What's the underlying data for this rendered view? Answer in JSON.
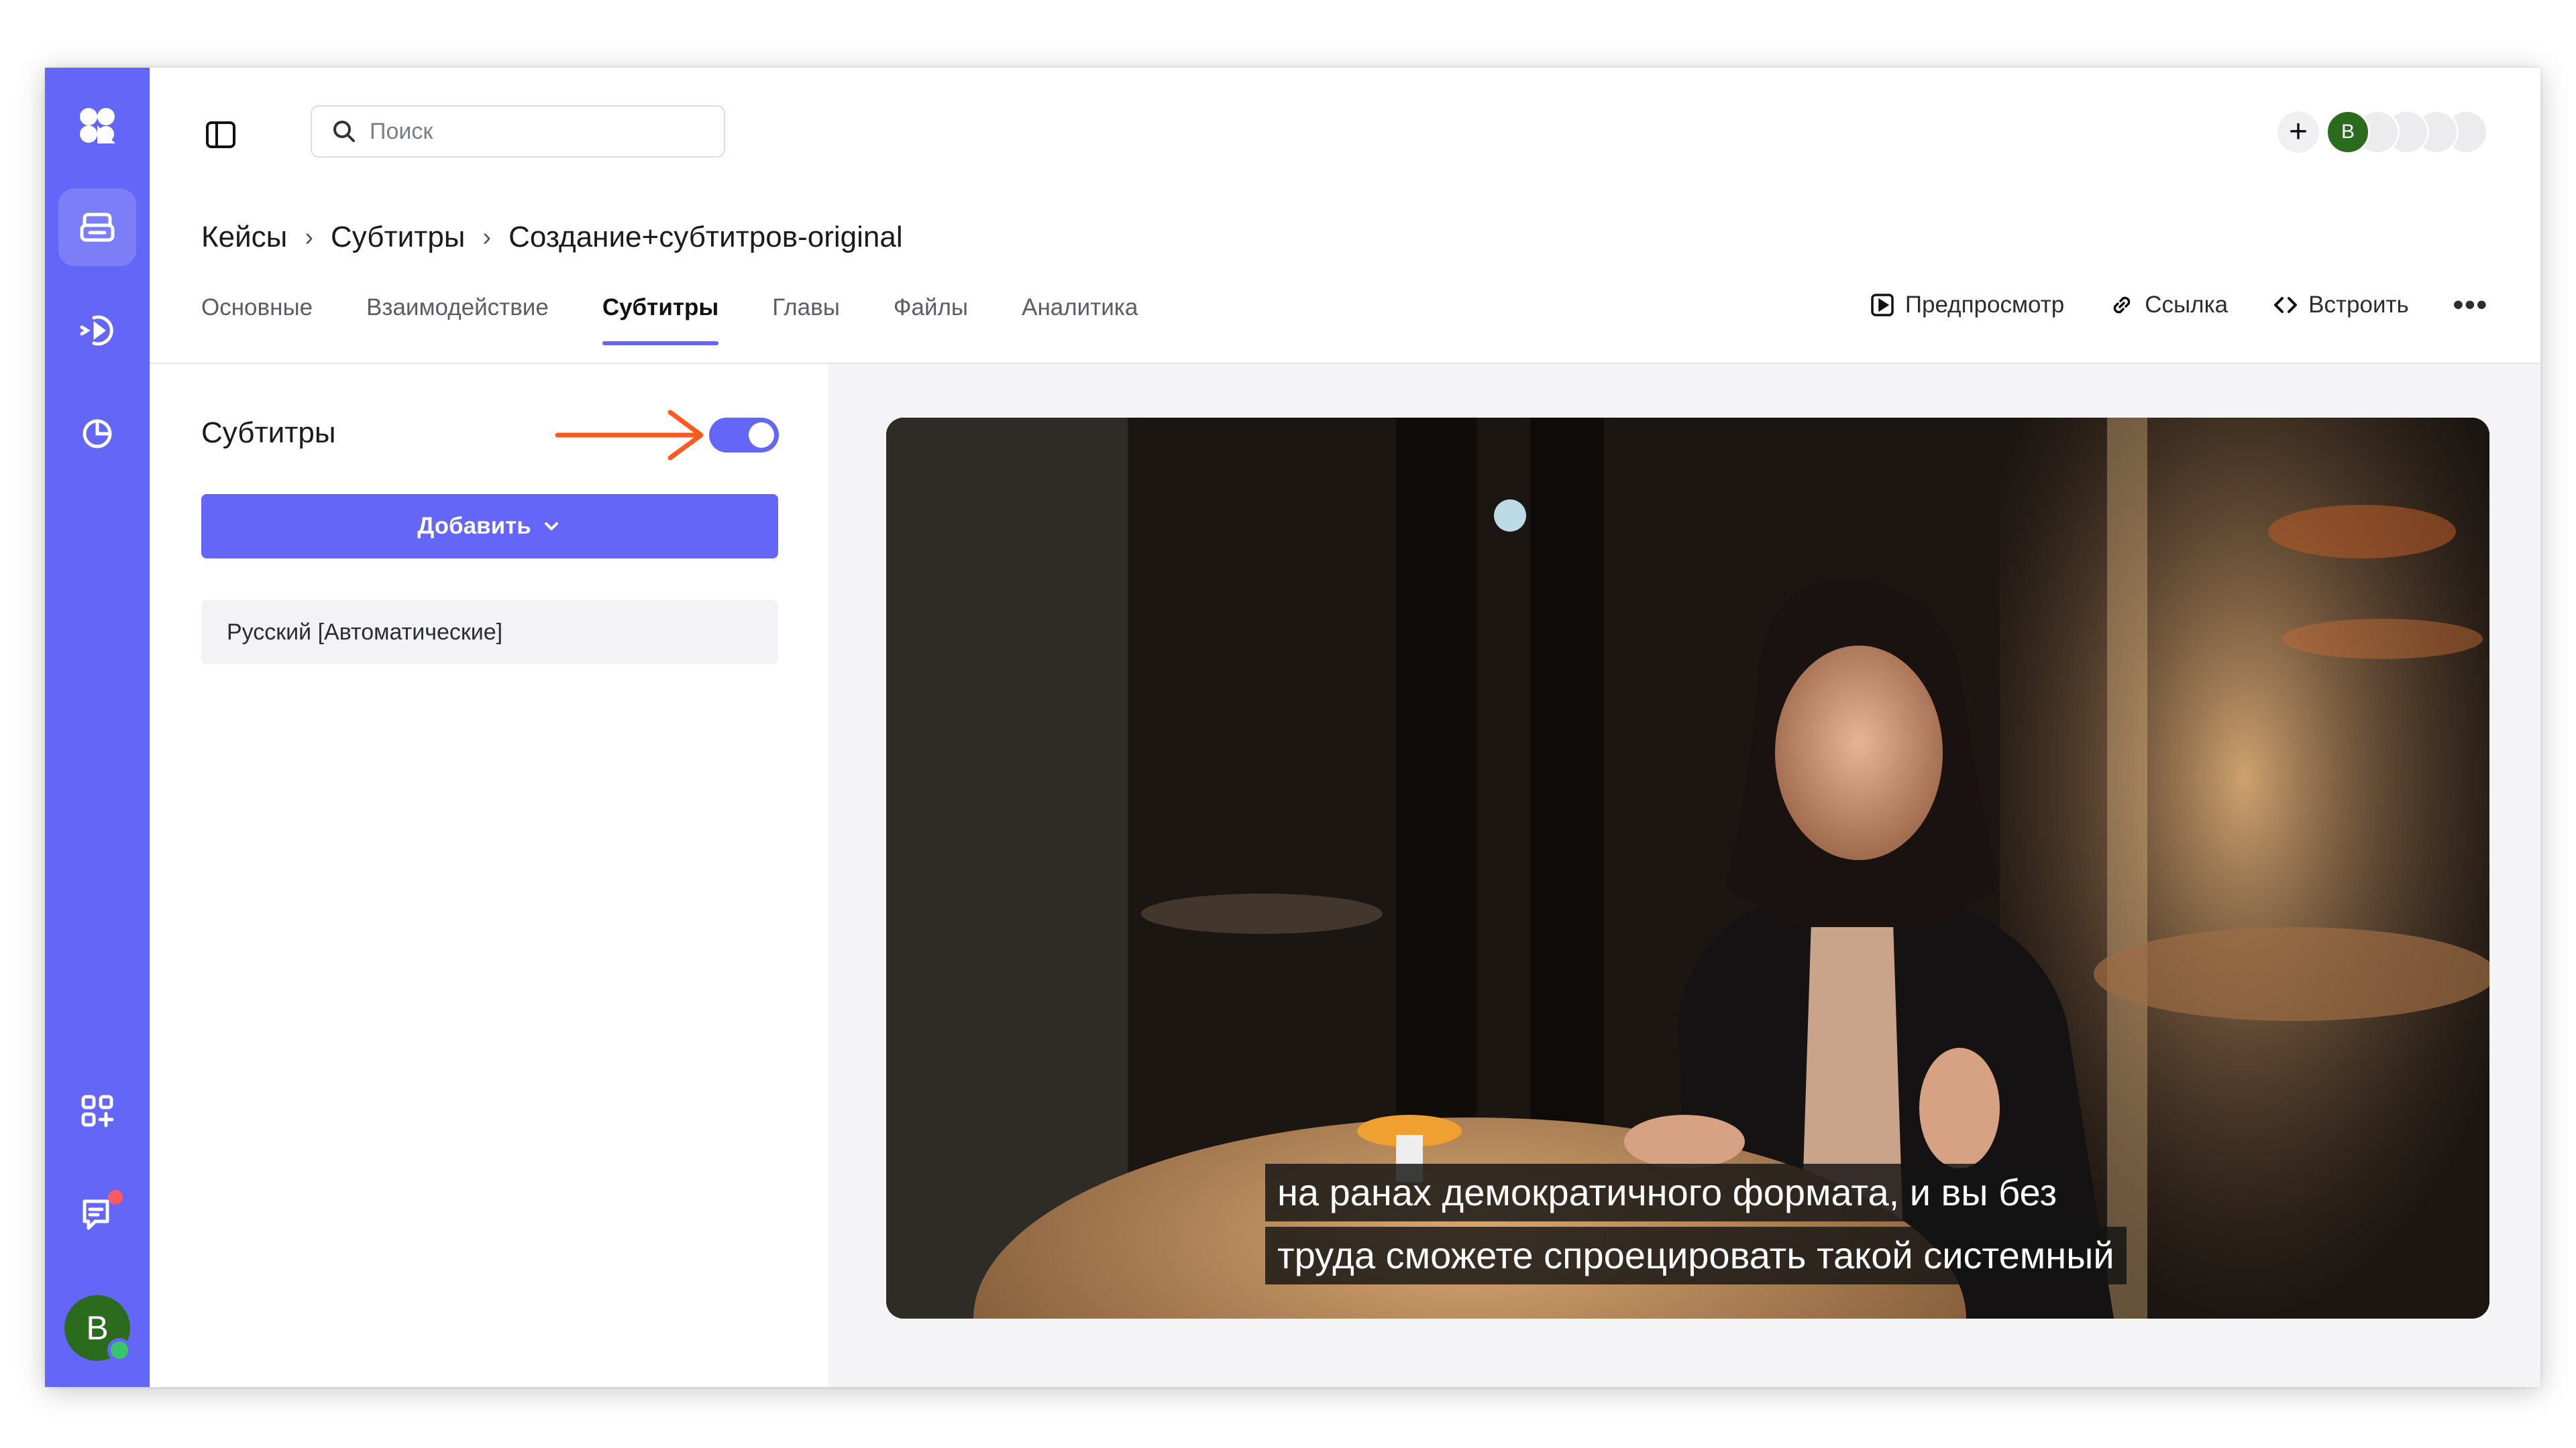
{
  "search": {
    "placeholder": "Поиск"
  },
  "header": {
    "avatar_letter": "B"
  },
  "breadcrumb": [
    "Кейсы",
    "Субтитры",
    "Создание+субтитров-original"
  ],
  "tabs": [
    {
      "label": "Основные"
    },
    {
      "label": "Взаимодействие"
    },
    {
      "label": "Субтитры",
      "active": true
    },
    {
      "label": "Главы"
    },
    {
      "label": "Файлы"
    },
    {
      "label": "Аналитика"
    }
  ],
  "actions": {
    "preview": "Предпросмотр",
    "link": "Ссылка",
    "embed": "Встроить"
  },
  "subtitles_panel": {
    "title": "Субтитры",
    "enabled": true,
    "add_button": "Добавить",
    "tracks": [
      "Русский [Автоматические]"
    ]
  },
  "video": {
    "caption_lines": [
      "на ранах демократичного формата, и вы без",
      "труда сможете спроецировать такой системный"
    ]
  },
  "sidebar": {
    "avatar_letter": "B"
  },
  "colors": {
    "accent": "#6366f6",
    "avatar": "#2a6b1e",
    "arrow": "#ff5a1f"
  }
}
